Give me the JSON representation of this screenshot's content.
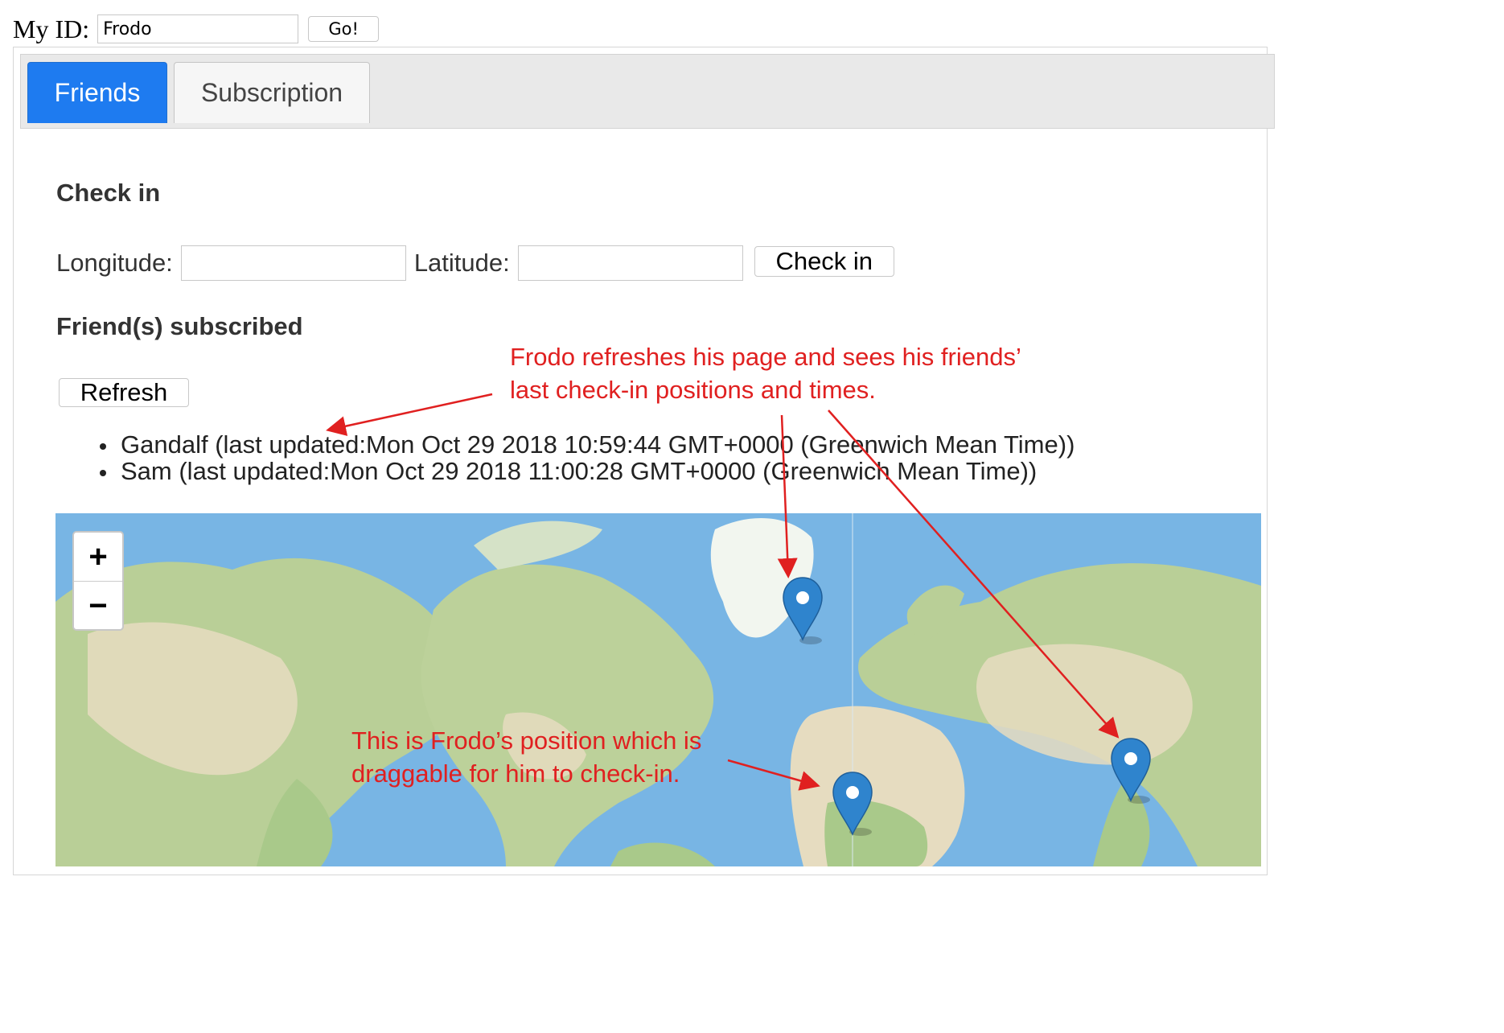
{
  "header": {
    "my_id_label": "My ID:",
    "my_id_value": "Frodo",
    "go_label": "Go!"
  },
  "tabs": [
    {
      "label": "Friends",
      "active": true
    },
    {
      "label": "Subscription",
      "active": false
    }
  ],
  "checkin": {
    "heading": "Check in",
    "longitude_label": "Longitude:",
    "longitude_value": "",
    "latitude_label": "Latitude:",
    "latitude_value": "",
    "button_label": "Check in"
  },
  "friends": {
    "heading": "Friend(s) subscribed",
    "refresh_label": "Refresh",
    "items": [
      "Gandalf (last updated:Mon Oct 29 2018 10:59:44 GMT+0000 (Greenwich Mean Time))",
      "Sam (last updated:Mon Oct 29 2018 11:00:28 GMT+0000 (Greenwich Mean Time))"
    ]
  },
  "map": {
    "zoom_in": "+",
    "zoom_out": "−",
    "markers": [
      "gandalf-marker",
      "frodo-marker",
      "sam-marker"
    ]
  },
  "annotations": {
    "top_line1": "Frodo refreshes his page and sees his friends’",
    "top_line2": "last check-in positions and times.",
    "bottom_line1": "This is Frodo’s position which is",
    "bottom_line2": "draggable for him to check-in."
  },
  "colors": {
    "tab_active": "#1e7bf0",
    "annotation": "#e02020",
    "marker": "#2f84cd",
    "water": "#78b5e4"
  }
}
